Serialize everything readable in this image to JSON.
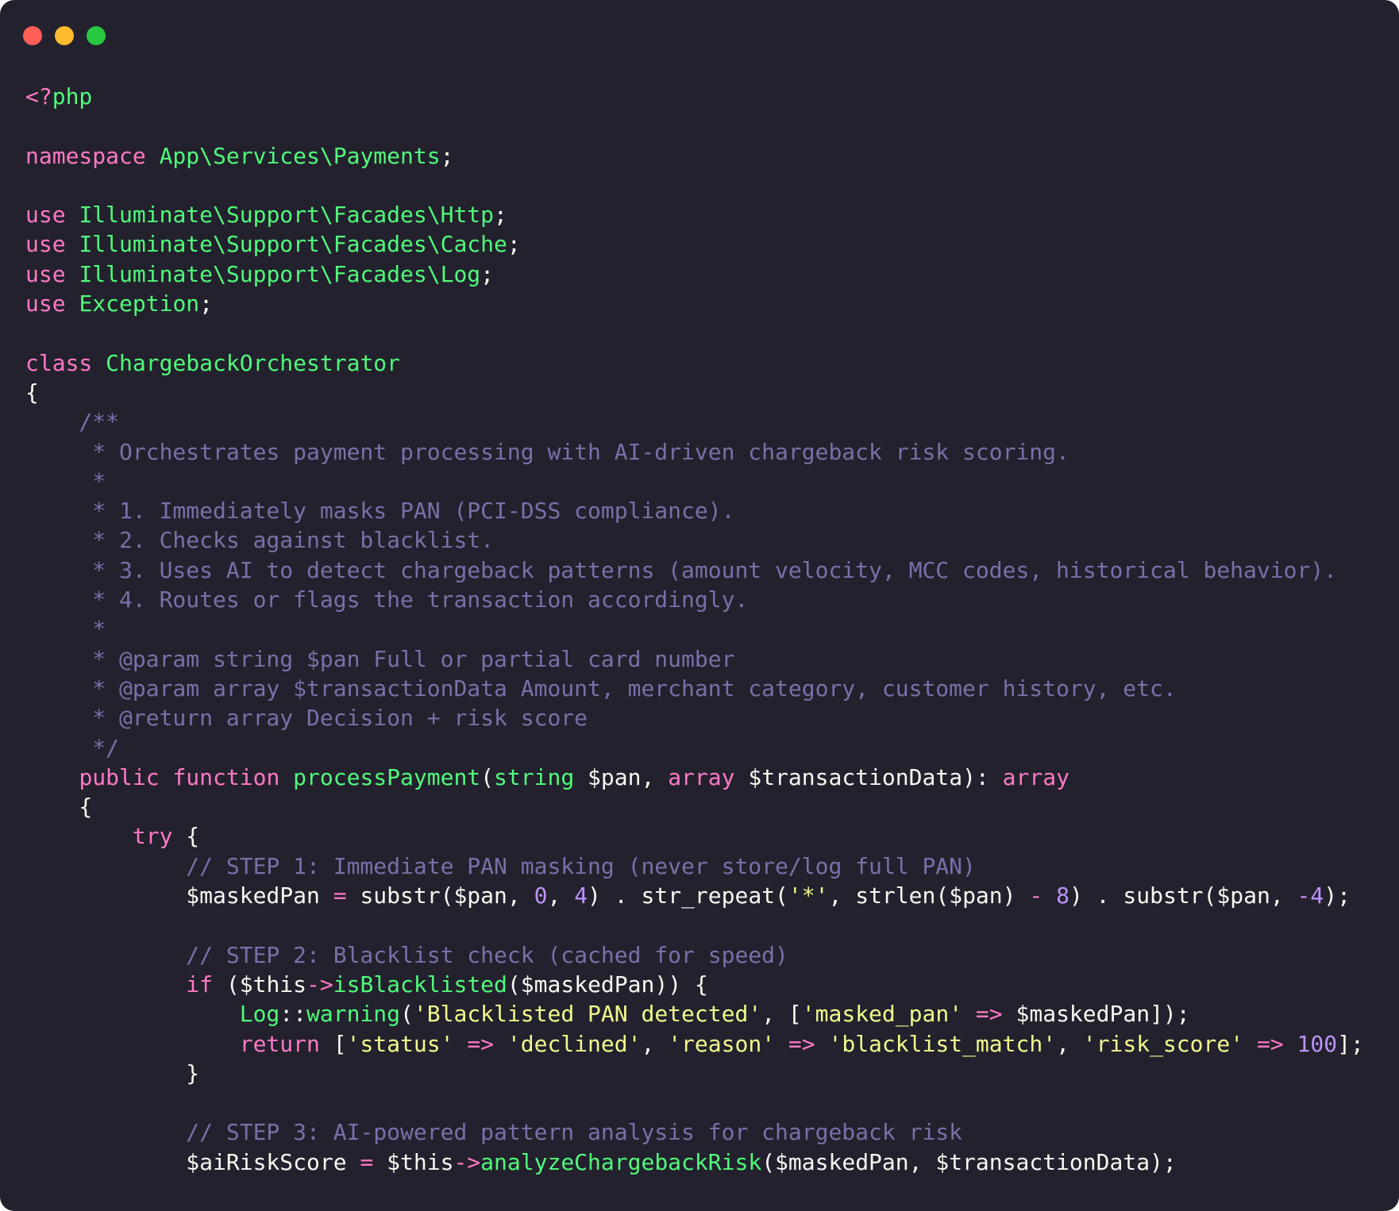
{
  "window": {
    "controls": [
      {
        "name": "close",
        "color": "#ff5f57"
      },
      {
        "name": "minimize",
        "color": "#febc2e"
      },
      {
        "name": "zoom",
        "color": "#28c840"
      }
    ]
  },
  "code_lines": [
    [
      [
        "kw",
        "<?"
      ],
      [
        "ty",
        "php"
      ]
    ],
    [],
    [
      [
        "kw",
        "namespace "
      ],
      [
        "ty",
        "App\\Services\\Payments"
      ],
      [
        "pl",
        ";"
      ]
    ],
    [],
    [
      [
        "kw",
        "use "
      ],
      [
        "ty",
        "Illuminate\\Support\\Facades\\Http"
      ],
      [
        "pl",
        ";"
      ]
    ],
    [
      [
        "kw",
        "use "
      ],
      [
        "ty",
        "Illuminate\\Support\\Facades\\Cache"
      ],
      [
        "pl",
        ";"
      ]
    ],
    [
      [
        "kw",
        "use "
      ],
      [
        "ty",
        "Illuminate\\Support\\Facades\\Log"
      ],
      [
        "pl",
        ";"
      ]
    ],
    [
      [
        "kw",
        "use "
      ],
      [
        "ty",
        "Exception"
      ],
      [
        "pl",
        ";"
      ]
    ],
    [],
    [
      [
        "kw",
        "class "
      ],
      [
        "ty",
        "ChargebackOrchestrator"
      ]
    ],
    [
      [
        "pl",
        "{"
      ]
    ],
    [
      [
        "cm",
        "    /**"
      ]
    ],
    [
      [
        "cm",
        "     * Orchestrates payment processing with AI-driven chargeback risk scoring."
      ]
    ],
    [
      [
        "cm",
        "     *"
      ]
    ],
    [
      [
        "cm",
        "     * 1. Immediately masks PAN (PCI-DSS compliance)."
      ]
    ],
    [
      [
        "cm",
        "     * 2. Checks against blacklist."
      ]
    ],
    [
      [
        "cm",
        "     * 3. Uses AI to detect chargeback patterns (amount velocity, MCC codes, historical behavior)."
      ]
    ],
    [
      [
        "cm",
        "     * 4. Routes or flags the transaction accordingly."
      ]
    ],
    [
      [
        "cm",
        "     *"
      ]
    ],
    [
      [
        "cm",
        "     * @param string $pan Full or partial card number"
      ]
    ],
    [
      [
        "cm",
        "     * @param array $transactionData Amount, merchant category, customer history, etc."
      ]
    ],
    [
      [
        "cm",
        "     * @return array Decision + risk score"
      ]
    ],
    [
      [
        "cm",
        "     */"
      ]
    ],
    [
      [
        "pl",
        "    "
      ],
      [
        "kw",
        "public function "
      ],
      [
        "fn",
        "processPayment"
      ],
      [
        "pl",
        "("
      ],
      [
        "ty",
        "string"
      ],
      [
        "pl",
        " $pan, "
      ],
      [
        "kw",
        "array"
      ],
      [
        "pl",
        " $transactionData): "
      ],
      [
        "kw",
        "array"
      ]
    ],
    [
      [
        "pl",
        "    {"
      ]
    ],
    [
      [
        "pl",
        "        "
      ],
      [
        "kw",
        "try"
      ],
      [
        "pl",
        " {"
      ]
    ],
    [
      [
        "cm",
        "            // STEP 1: Immediate PAN masking (never store/log full PAN)"
      ]
    ],
    [
      [
        "pl",
        "            $maskedPan "
      ],
      [
        "op",
        "="
      ],
      [
        "pl",
        " substr($pan, "
      ],
      [
        "num",
        "0"
      ],
      [
        "pl",
        ", "
      ],
      [
        "num",
        "4"
      ],
      [
        "pl",
        ") . str_repeat("
      ],
      [
        "str",
        "'*'"
      ],
      [
        "pl",
        ", strlen($pan) "
      ],
      [
        "op",
        "-"
      ],
      [
        "pl",
        " "
      ],
      [
        "num",
        "8"
      ],
      [
        "pl",
        ") . substr($pan, "
      ],
      [
        "num",
        "-4"
      ],
      [
        "pl",
        ");"
      ]
    ],
    [],
    [
      [
        "cm",
        "            // STEP 2: Blacklist check (cached for speed)"
      ]
    ],
    [
      [
        "pl",
        "            "
      ],
      [
        "kw",
        "if"
      ],
      [
        "pl",
        " ($this"
      ],
      [
        "op",
        "->"
      ],
      [
        "fn",
        "isBlacklisted"
      ],
      [
        "pl",
        "($maskedPan)) {"
      ]
    ],
    [
      [
        "pl",
        "                "
      ],
      [
        "ty",
        "Log"
      ],
      [
        "pl",
        "::"
      ],
      [
        "fn",
        "warning"
      ],
      [
        "pl",
        "("
      ],
      [
        "str",
        "'Blacklisted PAN detected'"
      ],
      [
        "pl",
        ", ["
      ],
      [
        "str",
        "'masked_pan'"
      ],
      [
        "pl",
        " "
      ],
      [
        "op",
        "=>"
      ],
      [
        "pl",
        " $maskedPan]);"
      ]
    ],
    [
      [
        "pl",
        "                "
      ],
      [
        "kw",
        "return"
      ],
      [
        "pl",
        " ["
      ],
      [
        "str",
        "'status'"
      ],
      [
        "pl",
        " "
      ],
      [
        "op",
        "=>"
      ],
      [
        "pl",
        " "
      ],
      [
        "str",
        "'declined'"
      ],
      [
        "pl",
        ", "
      ],
      [
        "str",
        "'reason'"
      ],
      [
        "pl",
        " "
      ],
      [
        "op",
        "=>"
      ],
      [
        "pl",
        " "
      ],
      [
        "str",
        "'blacklist_match'"
      ],
      [
        "pl",
        ", "
      ],
      [
        "str",
        "'risk_score'"
      ],
      [
        "pl",
        " "
      ],
      [
        "op",
        "=>"
      ],
      [
        "pl",
        " "
      ],
      [
        "num",
        "100"
      ],
      [
        "pl",
        "];"
      ]
    ],
    [
      [
        "pl",
        "            }"
      ]
    ],
    [],
    [
      [
        "cm",
        "            // STEP 3: AI-powered pattern analysis for chargeback risk"
      ]
    ],
    [
      [
        "pl",
        "            $aiRiskScore "
      ],
      [
        "op",
        "="
      ],
      [
        "pl",
        " $this"
      ],
      [
        "op",
        "->"
      ],
      [
        "fn",
        "analyzeChargebackRisk"
      ],
      [
        "pl",
        "($maskedPan, $transactionData);"
      ]
    ]
  ]
}
